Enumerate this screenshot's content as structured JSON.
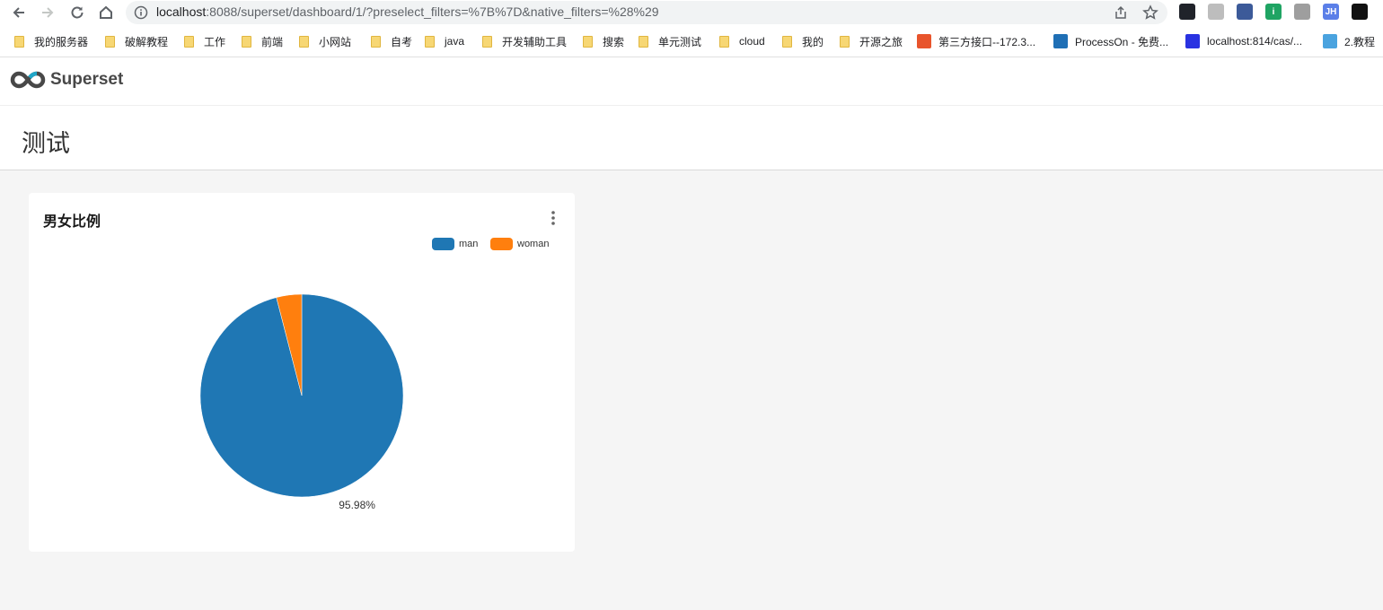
{
  "browser": {
    "url_host": "localhost",
    "url_rest": ":8088/superset/dashboard/1/?preselect_filters=%7B%7D&native_filters=%28%29",
    "extensions": [
      {
        "name": "react-devtools-icon",
        "label": "",
        "color": "#20232a"
      },
      {
        "name": "timer-extension-icon",
        "label": "",
        "color": "#bdbdbd"
      },
      {
        "name": "window-extension-icon",
        "label": "",
        "color": "#3c5a99"
      },
      {
        "name": "info-extension-icon",
        "label": "i",
        "color": "#1fa463"
      },
      {
        "name": "qr-extension-icon",
        "label": "",
        "color": "#9e9e9e"
      },
      {
        "name": "jh-extension-icon",
        "label": "JH",
        "color": "#5b7fe8"
      },
      {
        "name": "ghost-extension-icon",
        "label": "",
        "color": "#111111"
      }
    ]
  },
  "bookmarks": [
    {
      "label": "我的服务器",
      "type": "folder"
    },
    {
      "label": "破解教程",
      "type": "folder"
    },
    {
      "label": "工作",
      "type": "folder"
    },
    {
      "label": "前端",
      "type": "folder"
    },
    {
      "label": "小网站",
      "type": "folder"
    },
    {
      "label": "自考",
      "type": "folder"
    },
    {
      "label": "java",
      "type": "folder"
    },
    {
      "label": "开发辅助工具",
      "type": "folder"
    },
    {
      "label": "搜索",
      "type": "folder"
    },
    {
      "label": "单元测试",
      "type": "folder"
    },
    {
      "label": "cloud",
      "type": "folder"
    },
    {
      "label": "我的",
      "type": "folder"
    },
    {
      "label": "开源之旅",
      "type": "folder"
    },
    {
      "label": "第三方接口--172.3...",
      "type": "site",
      "icon": "api-icon",
      "color": "#e8542c"
    },
    {
      "label": "ProcessOn - 免费...",
      "type": "site",
      "icon": "processon-icon",
      "color": "#1f6fb5"
    },
    {
      "label": "localhost:814/cas/...",
      "type": "site",
      "icon": "paw-icon",
      "color": "#2932e1"
    },
    {
      "label": "2.教程",
      "type": "site",
      "icon": "loading-icon",
      "color": "#4aa3df"
    }
  ],
  "app": {
    "brand": "Superset"
  },
  "dashboard": {
    "title": "测试"
  },
  "chart": {
    "title": "男女比例"
  },
  "chart_data": {
    "type": "pie",
    "title": "男女比例",
    "categories": [
      "man",
      "woman"
    ],
    "values": [
      95.98,
      4.02
    ],
    "colors": [
      "#1f77b4",
      "#ff7f0e"
    ],
    "data_labels": [
      "95.98%",
      ""
    ],
    "legend_position": "top-right"
  }
}
